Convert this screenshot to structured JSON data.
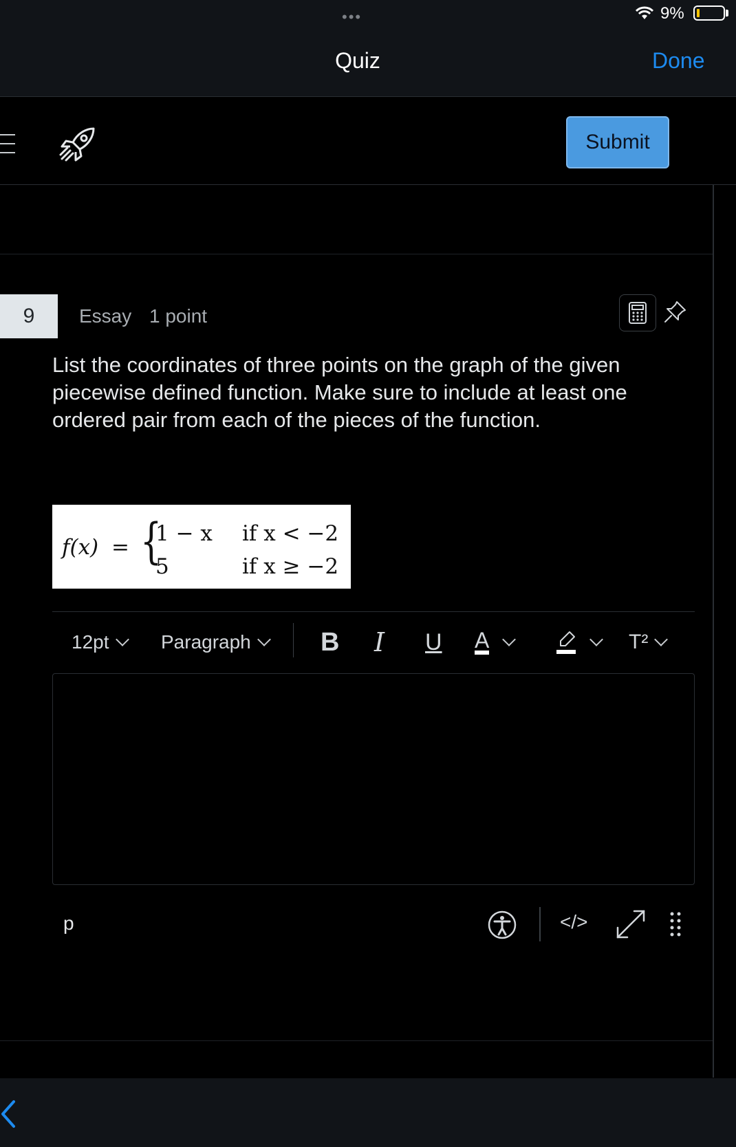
{
  "status_bar": {
    "dots": "•••",
    "battery_percent": "9%"
  },
  "nav": {
    "title": "Quiz",
    "done_label": "Done"
  },
  "app_header": {
    "submit_label": "Submit"
  },
  "question": {
    "number": "9",
    "type": "Essay",
    "points": "1 point",
    "prompt": "List the coordinates of three points on the graph of the given piecewise defined function. Make sure to include at least one ordered pair from each of the pieces of the function.",
    "formula": {
      "lhs": "f(x)",
      "equals": "=",
      "brace": "{",
      "piece1_expr": "1 − x",
      "piece1_cond": "if x < −2",
      "piece2_expr": "5",
      "piece2_cond": "if x ≥ −2"
    }
  },
  "editor_toolbar": {
    "font_size": "12pt",
    "block_format": "Paragraph",
    "bold": "B",
    "italic": "I",
    "underline": "U",
    "text_color": "A",
    "superscript": "T²"
  },
  "editor_status": {
    "path": "p",
    "code_view": "</>"
  },
  "icons": {
    "menu": "menu-icon",
    "rocket": "rocket-icon",
    "calculator": "calculator-icon",
    "pin": "pin-icon",
    "accessibility": "accessibility-icon",
    "expand": "expand-icon",
    "drag": "drag-handle-icon",
    "back": "back-icon"
  },
  "colors": {
    "accent": "#1d8bf0",
    "submit": "#4a9ae0",
    "battery_low": "#f2c200"
  }
}
